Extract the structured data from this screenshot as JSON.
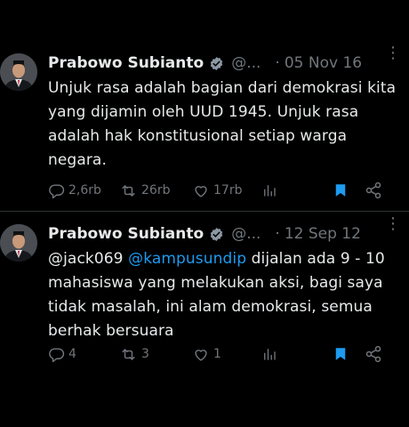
{
  "colors": {
    "background": "#000000",
    "text": "#e7e9ea",
    "muted": "#71767b",
    "link": "#1d9bf0",
    "verified_badge": "#8b98a5",
    "bookmark_active": "#1d9bf0"
  },
  "tweets": [
    {
      "author_name": "Prabowo Subianto",
      "handle": "@...",
      "separator": "·",
      "date": "05 Nov 16",
      "more": "⋮",
      "text": "Unjuk rasa adalah bagian dari demokrasi kita yang dijamin oleh UUD 1945. Unjuk rasa adalah hak konstitusional setiap warga negara.",
      "replies": "2,6rb",
      "retweets": "26rb",
      "likes": "17rb",
      "views": "",
      "bookmarked": true
    },
    {
      "author_name": "Prabowo Subianto",
      "handle": "@...",
      "separator": "·",
      "date": "12 Sep 12",
      "more": "⋮",
      "mention_plain": "@jack069",
      "mention_link": "@kampusundip",
      "text": " dijalan ada 9 - 10 mahasiswa yang melakukan aksi, bagi saya tidak masalah, ini alam demokrasi, semua berhak bersuara",
      "replies": "4",
      "retweets": "3",
      "likes": "1",
      "views": "",
      "bookmarked": true
    }
  ],
  "icons": {
    "avatar": "profile-photo",
    "verified": "verified-badge-icon",
    "reply": "reply-icon",
    "retweet": "retweet-icon",
    "like": "heart-icon",
    "views": "bar-chart-icon",
    "bookmark": "bookmark-icon",
    "share": "share-icon"
  }
}
